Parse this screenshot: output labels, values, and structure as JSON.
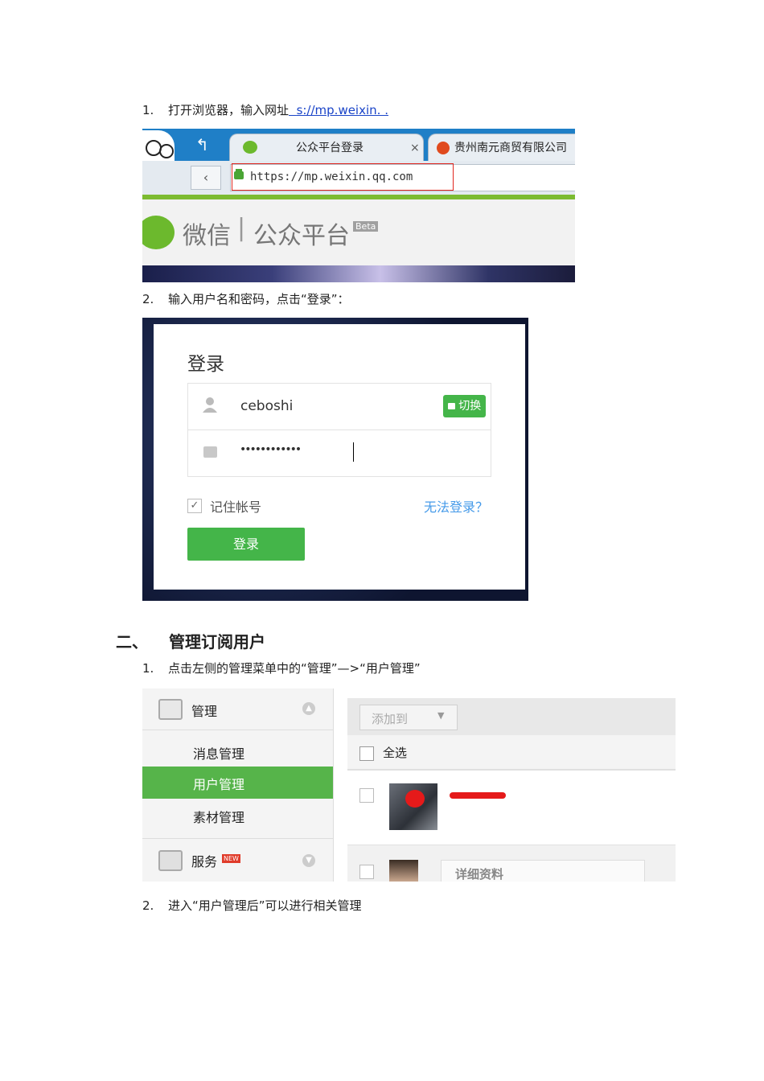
{
  "step1": {
    "num": "1.",
    "text": "打开浏览器，输入网址",
    "link": "s://mp.weixin.  .",
    "pre_link": "  "
  },
  "browser": {
    "tab_active": "公众平台登录",
    "tab_close": "×",
    "tab_other": "贵州南元商贸有限公司",
    "url": "https://mp.weixin.qq.com",
    "brand": "微信",
    "separator": "|",
    "platform": "公众平台",
    "beta": "Beta",
    "accent_color": "#7cbb31",
    "frame_color": "#e0261e"
  },
  "step2": {
    "num": "2.",
    "text": "输入用户名和密码，点击“登录”："
  },
  "login": {
    "title": "登录",
    "username": "ceboshi",
    "switch_label": "切换",
    "password_mask": "••••••••••••",
    "remember_label": "记住帐号",
    "cannot_login": "无法登录？",
    "submit_label": "登录",
    "button_color": "#44b549",
    "link_color": "#459ae9"
  },
  "section2": {
    "num": "二、",
    "title": "管理订阅用户"
  },
  "step3": {
    "num": "1.",
    "text": "点击左侧的管理菜单中的“管理”—>“用户管理”"
  },
  "admin": {
    "menu_header": "管理",
    "menu_items": [
      "消息管理",
      "用户管理",
      "素材管理"
    ],
    "active_index": 1,
    "service_label": "服务",
    "new_badge": "NEW",
    "add_to": "添加到",
    "select_all": "全选",
    "detail_label": "详细资料",
    "active_color": "#56b44a"
  },
  "step4": {
    "num": "2.",
    "text": "进入“用户管理后”可以进行相关管理"
  }
}
